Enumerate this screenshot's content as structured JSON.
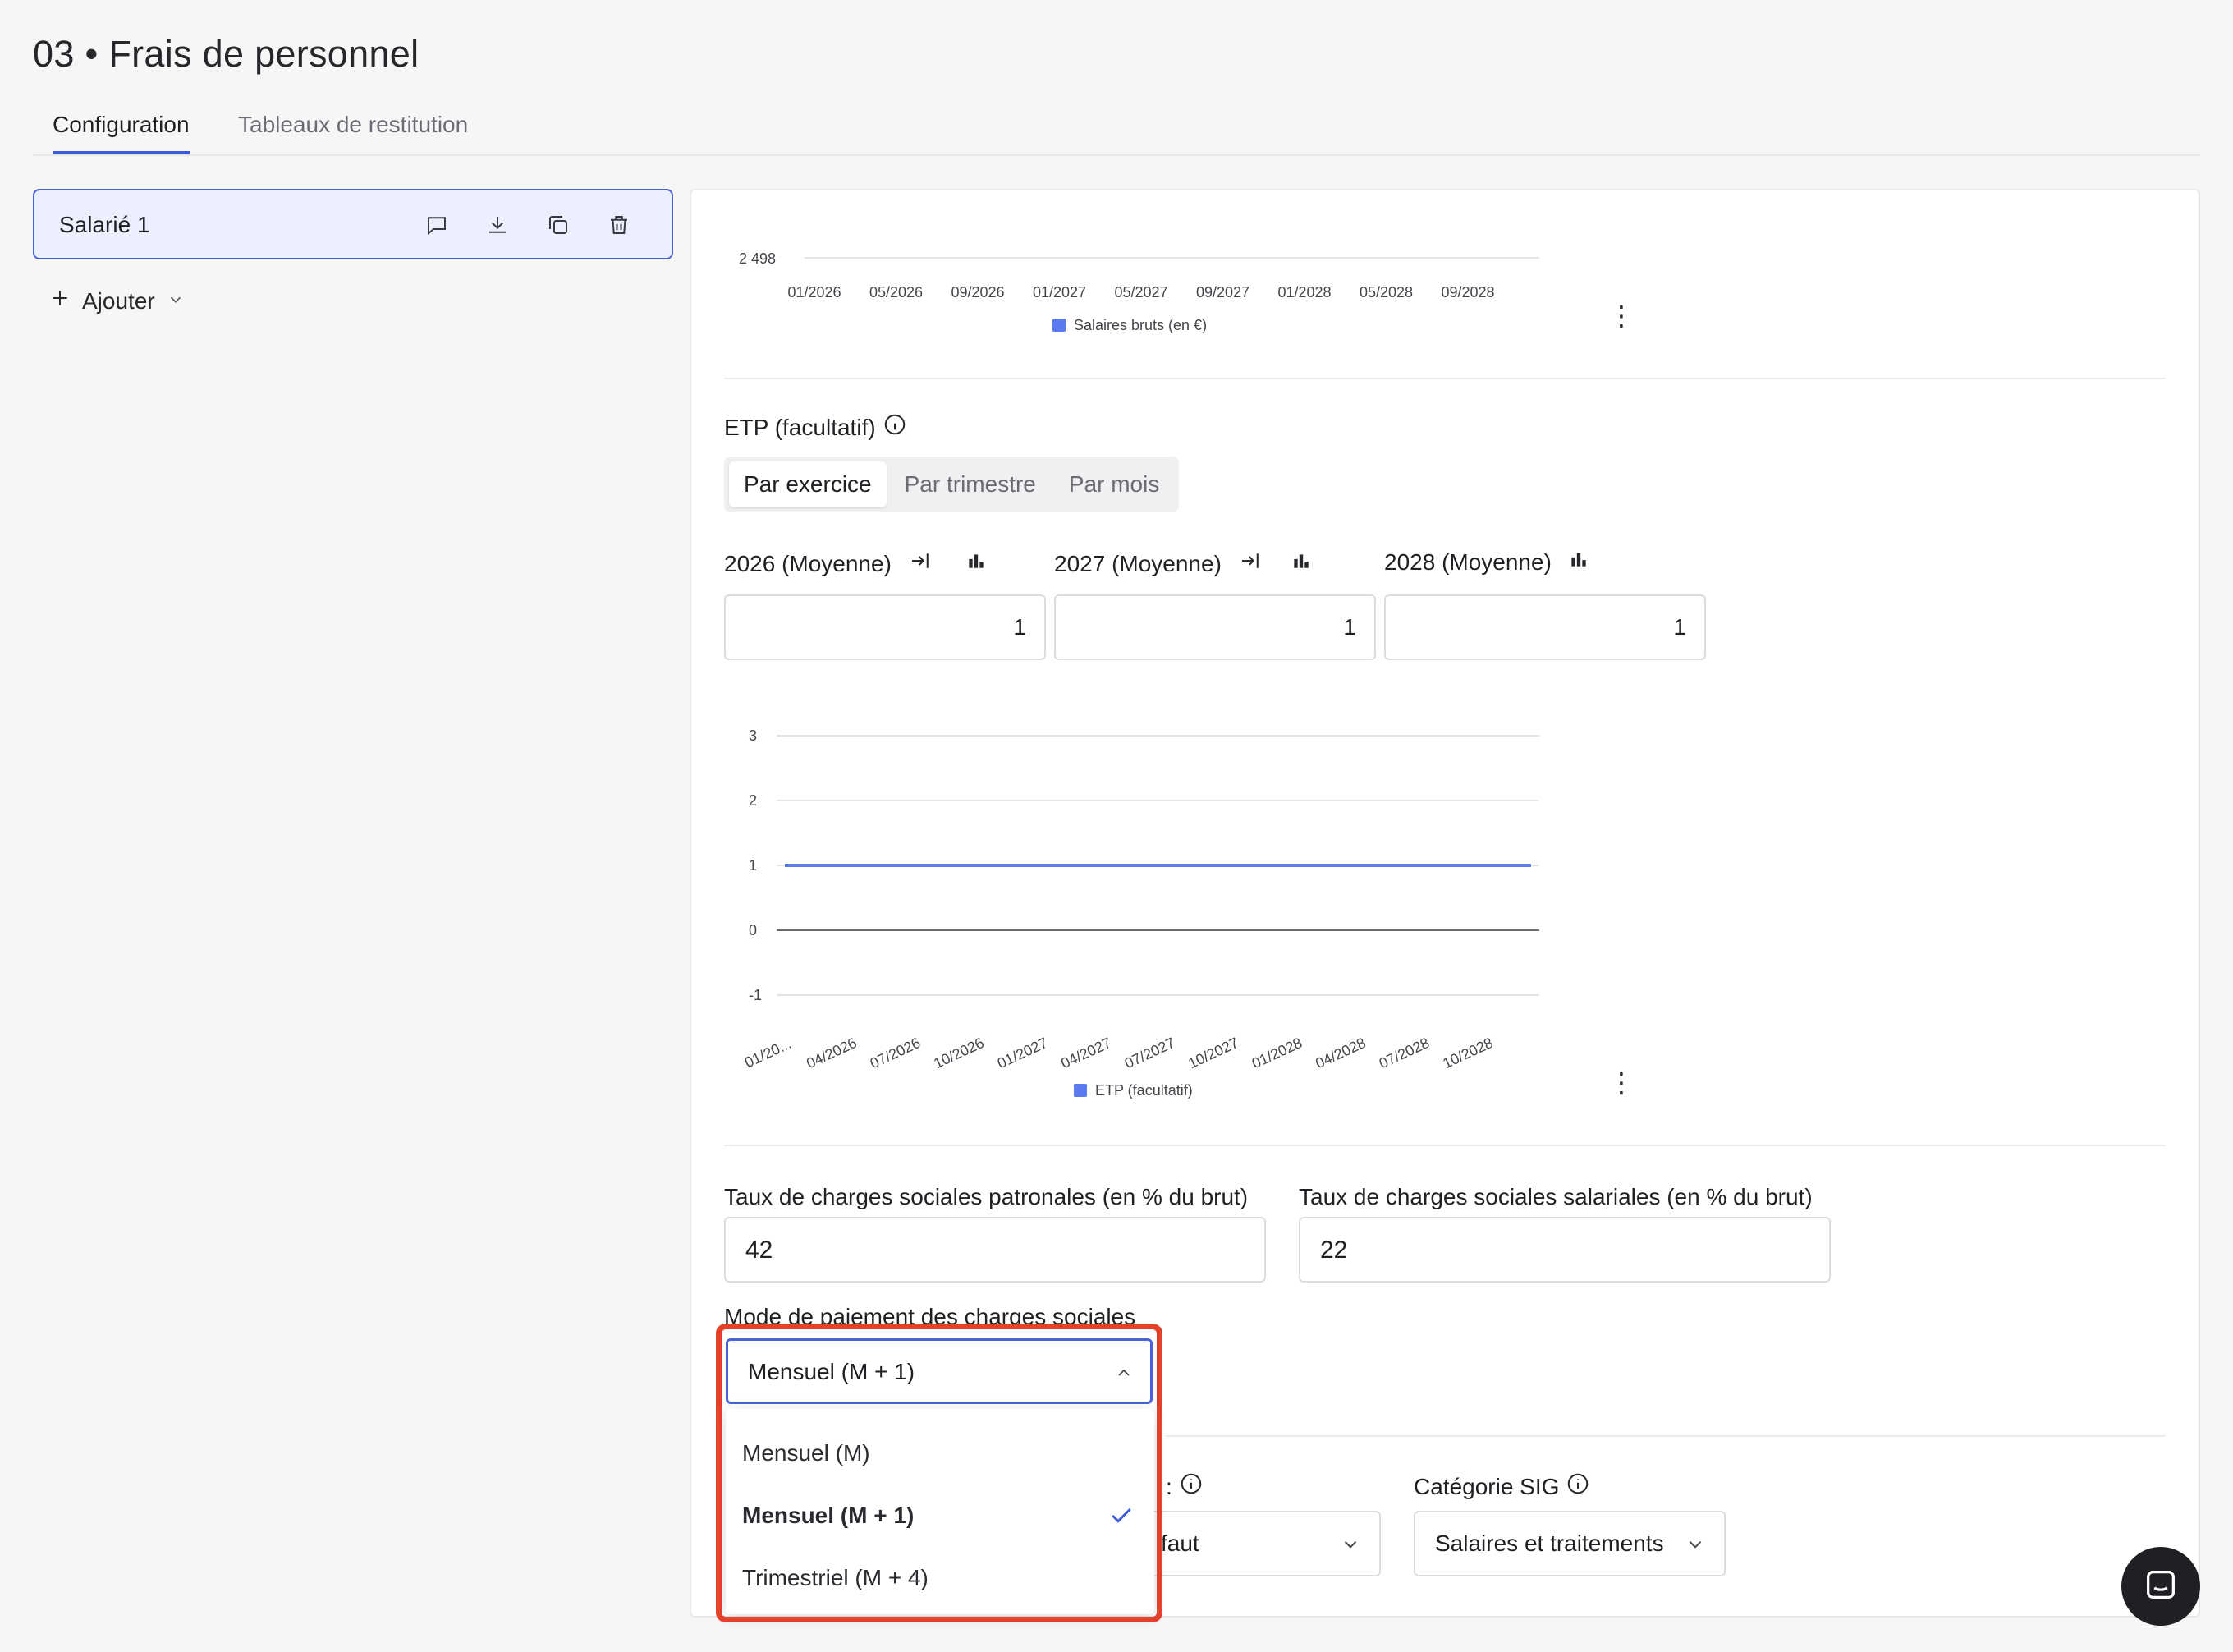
{
  "page": {
    "title": "03 • Frais de personnel"
  },
  "tabs": [
    {
      "label": "Configuration",
      "active": true
    },
    {
      "label": "Tableaux de restitution",
      "active": false
    }
  ],
  "sidebar": {
    "selected_item": "Salarié 1",
    "icons": [
      "comment-icon",
      "download-icon",
      "duplicate-icon",
      "trash-icon"
    ],
    "add_label": "Ajouter"
  },
  "salary_chart": {
    "chart_data": {
      "type": "line",
      "y_tick_visible": "2 498",
      "categories": [
        "01/2026",
        "05/2026",
        "09/2026",
        "01/2027",
        "05/2027",
        "09/2027",
        "01/2028",
        "05/2028",
        "09/2028"
      ],
      "legend": "Salaires bruts (en €)",
      "series_color": "#5b7cf0"
    }
  },
  "etp": {
    "label": "ETP (facultatif)",
    "segments": [
      "Par exercice",
      "Par trimestre",
      "Par mois"
    ],
    "active_segment": "Par exercice",
    "years": [
      {
        "label": "2026 (Moyenne)",
        "value": "1"
      },
      {
        "label": "2027 (Moyenne)",
        "value": "1"
      },
      {
        "label": "2028 (Moyenne)",
        "value": "1"
      }
    ],
    "chart_data": {
      "type": "line",
      "y_ticks": [
        "3",
        "2",
        "1",
        "0",
        "-1"
      ],
      "ylim": [
        -1,
        3
      ],
      "categories": [
        "01/20...",
        "04/2026",
        "07/2026",
        "10/2026",
        "01/2027",
        "04/2027",
        "07/2027",
        "10/2027",
        "01/2028",
        "04/2028",
        "07/2028",
        "10/2028"
      ],
      "series": [
        {
          "name": "ETP (facultatif)",
          "values": [
            1,
            1,
            1,
            1,
            1,
            1,
            1,
            1,
            1,
            1,
            1,
            1
          ]
        }
      ],
      "legend": "ETP (facultatif)",
      "series_color": "#5b7cf0"
    }
  },
  "charges": {
    "patronales_label": "Taux de charges sociales patronales (en % du brut)",
    "patronales_value": "42",
    "salariales_label": "Taux de charges sociales salariales (en % du brut)",
    "salariales_value": "22",
    "mode_label": "Mode de paiement des charges sociales",
    "mode_value": "Mensuel (M + 1)",
    "mode_options": [
      "Mensuel (M)",
      "Mensuel (M + 1)",
      "Trimestriel (M + 4)"
    ],
    "mode_selected": "Mensuel (M + 1)"
  },
  "bottom": {
    "hidden_select_partial": "faut",
    "sig_label": "Catégorie SIG",
    "sig_value": "Salaires et traitements"
  },
  "colors": {
    "accent": "#4a63d8",
    "highlight": "#e5402a",
    "series": "#5b7cf0"
  }
}
